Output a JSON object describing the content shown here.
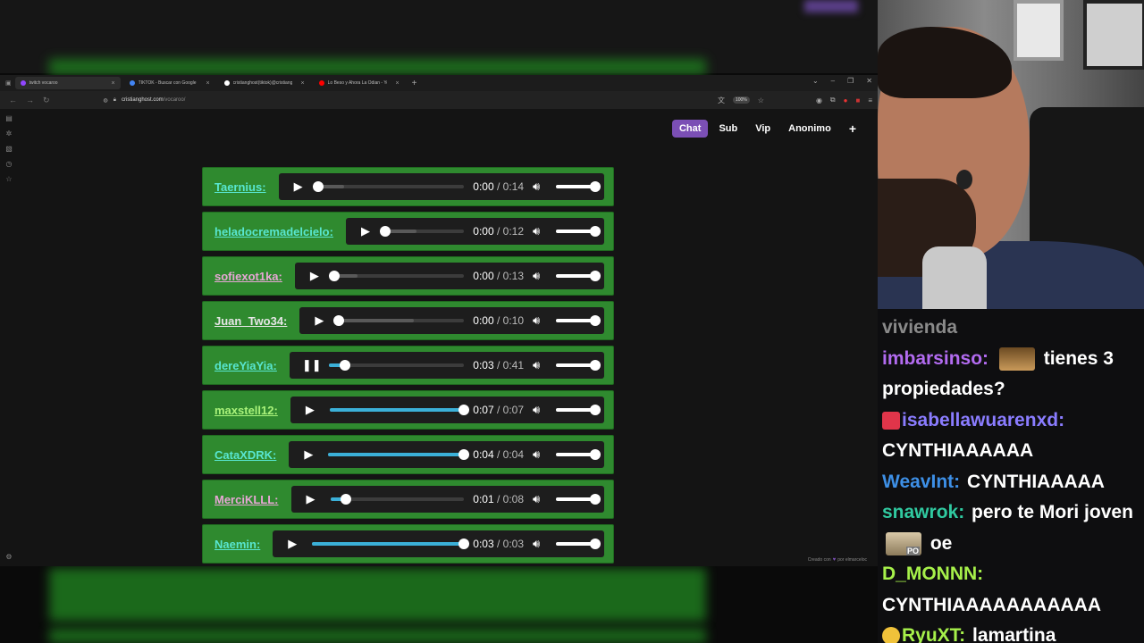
{
  "browser": {
    "tabs": [
      {
        "label": "twitch vocaroo",
        "active": true,
        "icon_color": "#9146ff"
      },
      {
        "label": "TIKTOK - Buscar con Google",
        "active": false,
        "icon_color": "#4285f4"
      },
      {
        "label": "cristianghost(tiktok)@cristianghost",
        "active": false,
        "icon_color": "#ffffff"
      },
      {
        "label": "Lo Beso y Ahora La Odian - You",
        "active": false,
        "icon_color": "#ff0000"
      }
    ],
    "url_host": "cristianghost.com",
    "url_path": "/vocaroo/",
    "zoom": "100%"
  },
  "page": {
    "nav": [
      "Chat",
      "Sub",
      "Vip",
      "Anonimo"
    ],
    "active_nav": "Chat",
    "plus_label": "+",
    "credit_prefix": "Creado con",
    "credit_suffix": "por elmarceloc",
    "audio_rows": [
      {
        "user": "Taernius:",
        "color": "teal",
        "state": "paused",
        "current": "0:00",
        "duration": "0:14",
        "progress": 0,
        "buffered": 0.18
      },
      {
        "user": "heladocremadelcielo:",
        "color": "teal",
        "state": "paused",
        "current": "0:00",
        "duration": "0:12",
        "progress": 0,
        "buffered": 0.4
      },
      {
        "user": "sofiexot1ka:",
        "color": "pink",
        "state": "paused",
        "current": "0:00",
        "duration": "0:13",
        "progress": 0,
        "buffered": 0.18
      },
      {
        "user": "Juan_Two34:",
        "color": "white",
        "state": "paused",
        "current": "0:00",
        "duration": "0:10",
        "progress": 0,
        "buffered": 0.6
      },
      {
        "user": "dereYiaYia:",
        "color": "teal",
        "state": "playing",
        "current": "0:03",
        "duration": "0:41",
        "progress": 0.12,
        "buffered": 0.12
      },
      {
        "user": "maxstell12:",
        "color": "green",
        "state": "paused",
        "current": "0:07",
        "duration": "0:07",
        "progress": 1,
        "buffered": 1
      },
      {
        "user": "CataXDRK:",
        "color": "teal",
        "state": "paused",
        "current": "0:04",
        "duration": "0:04",
        "progress": 1,
        "buffered": 1
      },
      {
        "user": "MerciKLLL:",
        "color": "pink",
        "state": "paused",
        "current": "0:01",
        "duration": "0:08",
        "progress": 0.12,
        "buffered": 0.12
      },
      {
        "user": "Naemin:",
        "color": "teal",
        "state": "paused",
        "current": "0:03",
        "duration": "0:03",
        "progress": 1,
        "buffered": 1
      }
    ]
  },
  "chat": {
    "messages": [
      {
        "user": "",
        "text": "vivienda",
        "faded": true
      },
      {
        "user": "imbarsinso:",
        "user_color": "#b26bf0",
        "emote": "face",
        "text": "tienes 3 propiedades?"
      },
      {
        "user": "isabellawuarenxd:",
        "user_color": "#8a7cff",
        "badge": "rocket",
        "text": "CYNTHIAAAAAA"
      },
      {
        "user": "WeavInt:",
        "user_color": "#3d8fe6",
        "text": "CYNTHIAAAAA"
      },
      {
        "user": "snawrok:",
        "user_color": "#30c9a0",
        "text": "pero te Mori joven",
        "emote_after": "cat",
        "emote_label": "PO",
        "tail": "oe"
      },
      {
        "user": "D_MONNN:",
        "user_color": "#a6f04a",
        "text": "CYNTHIAAAAAAAAAAA"
      },
      {
        "user": "RyuXT:",
        "user_color": "#a6f04a",
        "badge": "duck",
        "text": "lamartina"
      }
    ]
  }
}
